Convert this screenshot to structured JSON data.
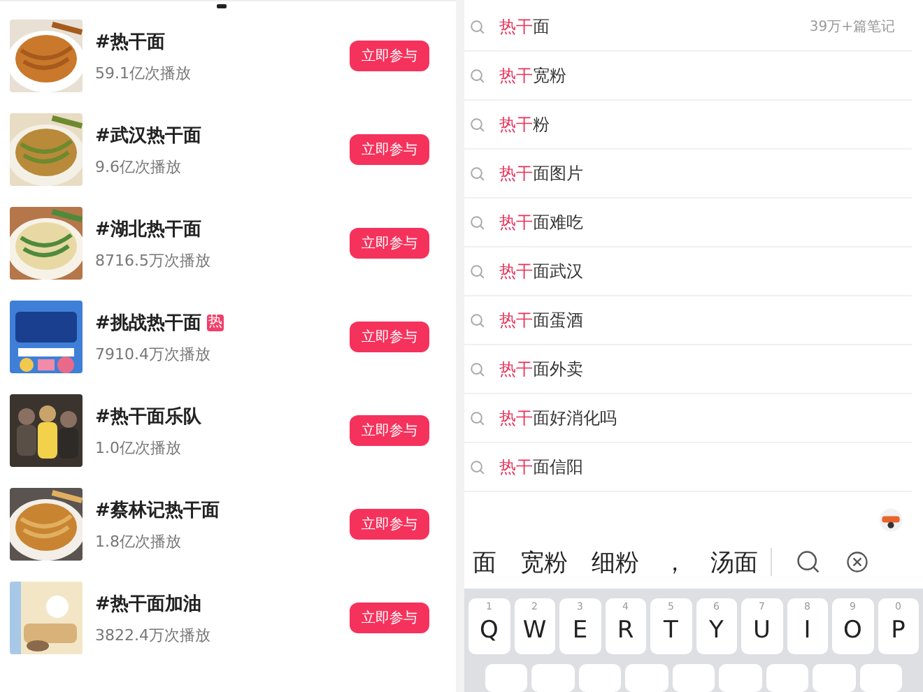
{
  "topics": [
    {
      "title": "#热干面",
      "plays": "59.1亿次播放",
      "button": "立即参与"
    },
    {
      "title": "#武汉热干面",
      "plays": "9.6亿次播放",
      "button": "立即参与"
    },
    {
      "title": "#湖北热干面",
      "plays": "8716.5万次播放",
      "button": "立即参与"
    },
    {
      "title": "#挑战热干面",
      "badge": "热",
      "plays": "7910.4万次播放",
      "button": "立即参与"
    },
    {
      "title": "#热干面乐队",
      "plays": "1.0亿次播放",
      "button": "立即参与"
    },
    {
      "title": "#蔡林记热干面",
      "plays": "1.8亿次播放",
      "button": "立即参与"
    },
    {
      "title": "#热干面加油",
      "plays": "3822.4万次播放",
      "button": "立即参与"
    }
  ],
  "suggestions": [
    {
      "match": "热干",
      "rest": "面",
      "count": "39万+篇笔记"
    },
    {
      "match": "热干",
      "rest": "宽粉"
    },
    {
      "match": "热干",
      "rest": "粉"
    },
    {
      "match": "热干",
      "rest": "面图片"
    },
    {
      "match": "热干",
      "rest": "面难吃"
    },
    {
      "match": "热干",
      "rest": "面武汉"
    },
    {
      "match": "热干",
      "rest": "面蛋酒"
    },
    {
      "match": "热干",
      "rest": "面外卖"
    },
    {
      "match": "热干",
      "rest": "面好消化吗"
    },
    {
      "match": "热干",
      "rest": "面信阳"
    }
  ],
  "keyboard": {
    "candidates": [
      "面",
      "宽粉",
      "细粉",
      "，",
      "汤面"
    ],
    "keys": [
      {
        "digit": "1",
        "letter": "Q"
      },
      {
        "digit": "2",
        "letter": "W"
      },
      {
        "digit": "3",
        "letter": "E"
      },
      {
        "digit": "4",
        "letter": "R"
      },
      {
        "digit": "5",
        "letter": "T"
      },
      {
        "digit": "6",
        "letter": "Y"
      },
      {
        "digit": "7",
        "letter": "U"
      },
      {
        "digit": "8",
        "letter": "I"
      },
      {
        "digit": "9",
        "letter": "O"
      },
      {
        "digit": "0",
        "letter": "P"
      }
    ]
  }
}
